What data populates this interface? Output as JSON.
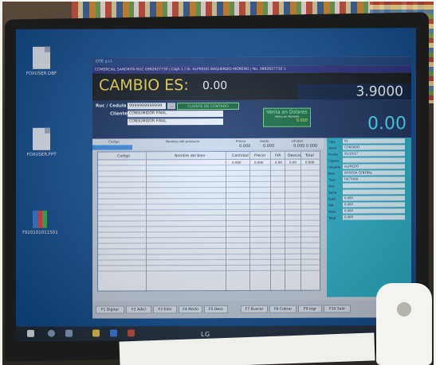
{
  "desktop": {
    "icons": [
      {
        "label": "FOXUSER.DBF"
      },
      {
        "label": "FOXUSER.FPT"
      },
      {
        "label": "7920101011501"
      }
    ]
  },
  "app": {
    "title": "DTE s.r.l.",
    "company_line": "COMERCIAL SANDRITA RUC 0992827730 | CAJA 1 | Sr. ALFREDO BAQUERIZO MORENO | No. 0992827730 1",
    "cambio_label": "CAMBIO ES:",
    "cambio_value": "0.00",
    "rate": "3.9000",
    "ruc_label": "Ruc / Cedula",
    "ruc_value": "9999999999999",
    "ruc_button": "...",
    "client_button": "CLIENTE DE CONTADO",
    "cliente_label": "Cliente",
    "cliente_value": "CONSUMIDOR FINAL",
    "cliente_value2": "CONSUMIDOR FINAL",
    "venta_title": "Venta en Dolares",
    "venta_sub": "Venta en Moneda",
    "venta_value": "0.000",
    "total": "0.00",
    "entry_headers": {
      "codigo": "Codigo",
      "nombre": "Nombre del producto",
      "precio": "Precio",
      "saldo": "Saldo",
      "unidad": "Unidad"
    },
    "entry_values": {
      "precio": "0.000",
      "saldo": "0.000",
      "unidad": "0.000 0.000"
    },
    "grid_headers": {
      "codigo": "Codigo",
      "nombre": "Nombre del Bien",
      "cantidad": "Cantidad",
      "precio": "Precio",
      "iva": "IVA",
      "descuento": "Descue.",
      "total": "Total"
    },
    "grid_first_row": {
      "cantidad": "0.000",
      "precio": "0.000",
      "iva": "0.00",
      "descuento": "0.00",
      "total": "0.000"
    },
    "side_panel": [
      {
        "k": "Caja",
        "v": "01"
      },
      {
        "k": "Vend",
        "v": "CONTADO"
      },
      {
        "k": "Fecha",
        "v": "01/10/17"
      },
      {
        "k": "Cajero",
        "v": ""
      },
      {
        "k": "Usuario",
        "v": "ALFREDO"
      },
      {
        "k": "Bod",
        "v": "BODEGA CENTRAL"
      },
      {
        "k": "Tipo",
        "v": "FACTURA"
      },
      {
        "k": "Doc",
        "v": ""
      },
      {
        "k": "Serie",
        "v": ""
      },
      {
        "k": "Subt",
        "v": "0.000"
      },
      {
        "k": "IVA",
        "v": "0.000"
      },
      {
        "k": "Desc",
        "v": "0.000"
      },
      {
        "k": "Total",
        "v": "0.000"
      }
    ],
    "fkeys": [
      {
        "label": "F1 Digitar"
      },
      {
        "label": "F2 Adicl"
      },
      {
        "label": "F3 Elim"
      },
      {
        "label": "F4 Modo"
      },
      {
        "label": "F5 Desc"
      },
      {
        "label": "F7 Buscar"
      },
      {
        "label": "F8 Cobrar"
      },
      {
        "label": "F9 Ingr"
      },
      {
        "label": "F10 Salir"
      }
    ]
  },
  "monitor_brand": "LG"
}
